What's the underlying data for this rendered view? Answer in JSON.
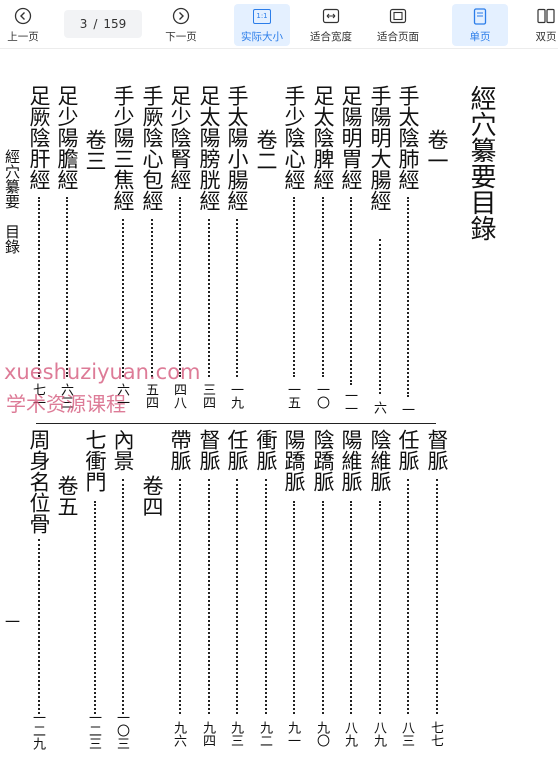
{
  "toolbar": {
    "prev_label": "上一页",
    "page_current": "3",
    "page_sep": "/",
    "page_total": "159",
    "next_label": "下一页",
    "actual_size_label": "实际大小",
    "actual_size_icon_text": "1:1",
    "fit_width_label": "适合宽度",
    "fit_page_label": "适合页面",
    "single_page_label": "单页",
    "double_page_label": "双页"
  },
  "doc": {
    "title": "經穴纂要目錄",
    "margin_header": "經穴纂要　目錄",
    "margin_folio": "一",
    "top_columns": {
      "c1": "卷一",
      "c2": "手太陰肺經",
      "c3": "手陽明大腸經",
      "c4": "足陽明胃經",
      "c5": "足太陰脾經",
      "c6": "手少陰心經",
      "c7": "卷二",
      "c8": "手太陽小腸經",
      "c9": "足太陽膀胱經",
      "c10": "足少陰腎經",
      "c11": "手厥陰心包經",
      "c12": "手少陽三焦經",
      "c13": "卷三",
      "c14": "足少陽膽經",
      "c15": "足厥陰肝經"
    },
    "top_numbers": {
      "n2": "一",
      "n3": "六",
      "n4": "一一",
      "n5": "一〇",
      "n6": "一五",
      "n8": "一九",
      "n9": "三四",
      "n10": "四八",
      "n11": "五四",
      "n12": "六一",
      "n14": "六三",
      "n15": "七一"
    },
    "bottom_columns": {
      "b1": "督脈",
      "b2": "任脈",
      "b3": "陰維脈",
      "b4": "陽維脈",
      "b5": "陰蹻脈",
      "b6": "陽蹻脈",
      "b7": "衝脈",
      "b8": "任脈",
      "b9": "督脈",
      "b10": "帶脈",
      "b11": "卷四",
      "b12": "內景",
      "b13": "七衝門",
      "b14": "卷五",
      "b15": "周身名位骨"
    },
    "bottom_numbers": {
      "m1": "七七",
      "m2": "八三",
      "m3": "八九",
      "m4": "八九",
      "m5": "九〇",
      "m6": "九一",
      "m7": "九二",
      "m8": "九三",
      "m9": "九四",
      "m10": "九六",
      "m12": "一〇三",
      "m13": "一二三",
      "m15": "一二九"
    }
  },
  "watermark": {
    "line1": "xueshuziyuan.com",
    "line2": "学术资源课程"
  },
  "colors": {
    "accent": "#2b7de9",
    "active_bg": "#e4f0ff",
    "watermark": "#d4577a"
  }
}
